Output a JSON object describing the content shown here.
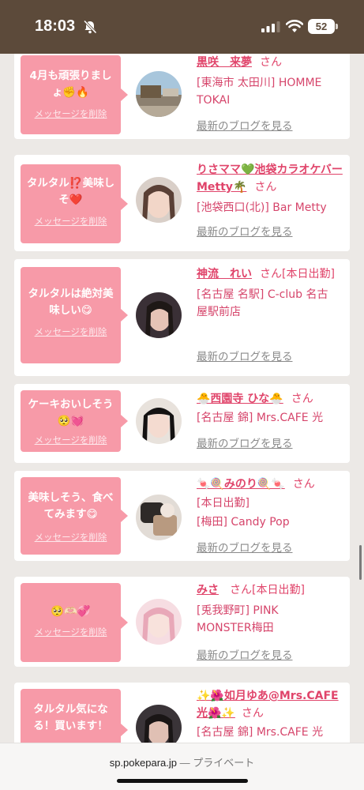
{
  "status": {
    "time": "18:03",
    "battery": "52",
    "bell_icon": "bell-slash-icon"
  },
  "browser": {
    "domain": "sp.pokepara.jp",
    "separator": "—",
    "mode": "プライベート"
  },
  "common": {
    "delete_label": "メッセージを削除",
    "blog_label": "最新のブログを見る",
    "san": "さん"
  },
  "cards": [
    {
      "message": "4月も頑張りましょ✊🔥",
      "name": "黒咲　来夢",
      "after_name": "",
      "lines": [
        "[東海市 太田川] HOMME",
        "TOKAI"
      ]
    },
    {
      "message": "タルタル⁉️美味しそ❤️",
      "name": "りさママ💚池袋カラオケバーMetty🌴",
      "after_name": "",
      "lines": [
        "[池袋西口(北)] Bar Metty"
      ]
    },
    {
      "message": "タルタルは絶対美味しい😋",
      "name": "神流　れい",
      "after_name": "[本日出勤]",
      "lines": [
        "[名古屋 名駅] C-club 名古",
        "屋駅前店"
      ]
    },
    {
      "message": "ケーキおいしそう🥺💓",
      "name": "🐣西園寺 ひな🐣",
      "after_name": "",
      "lines": [
        "[名古屋 錦] Mrs.CAFE 光"
      ]
    },
    {
      "message": "美味しそう、食べてみます😋",
      "name": "🍬🍭みのり🍭🍬",
      "after_name": "",
      "lines": [
        "[本日出勤]",
        "[梅田] Candy Pop"
      ]
    },
    {
      "message": "🥺🫶🏻💞",
      "name": "みさ",
      "after_name": "[本日出勤]",
      "lines": [
        "[兎我野町] PINK",
        "MONSTER梅田"
      ]
    },
    {
      "message": "タルタル気になる！買います！",
      "name": "✨🌺如月ゆあ@Mrs.CAFE光🌺✨",
      "after_name": "",
      "lines": [
        "[名古屋 錦] Mrs.CAFE 光"
      ]
    }
  ]
}
